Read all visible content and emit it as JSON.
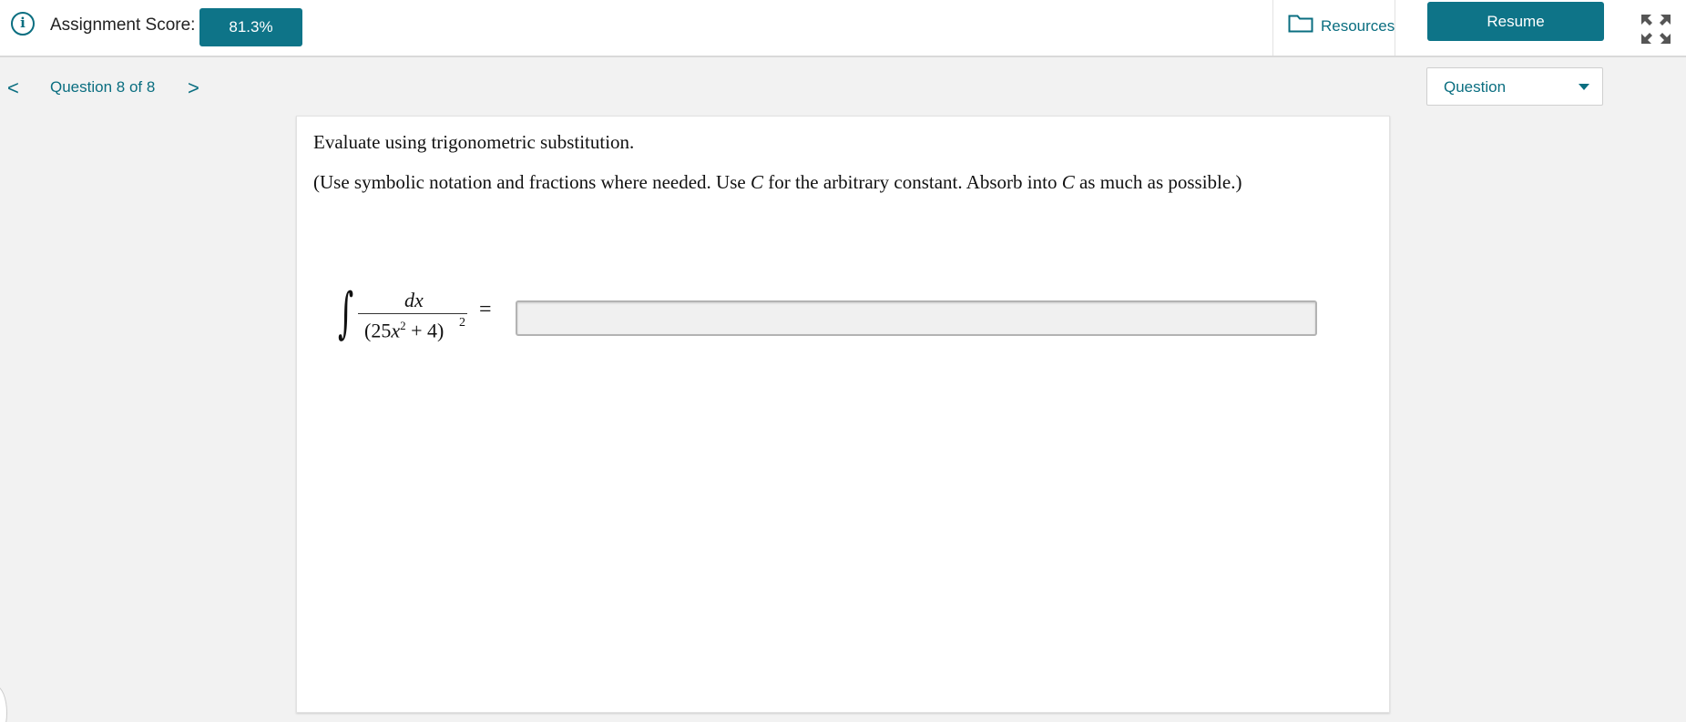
{
  "header": {
    "info_icon": "info-icon",
    "score_label": "Assignment Score:",
    "score_value": "81.3%",
    "resources_label": "Resources",
    "resume_label": "Resume",
    "fullscreen_icon": "fullscreen-icon"
  },
  "nav": {
    "prev_glyph": "<",
    "question_label": "Question 8 of 8",
    "next_glyph": ">"
  },
  "view_select": {
    "selected": "Question"
  },
  "question": {
    "prompt": "Evaluate using trigonometric substitution.",
    "instructions_pre": "(Use symbolic notation and fractions where needed. Use ",
    "constant": "C",
    "instructions_mid": " for the arbitrary constant. Absorb into ",
    "instructions_post": " as much as possible.)",
    "integral": {
      "sign": "∫",
      "numerator": "dx",
      "denominator_open": "(25",
      "denominator_var": "x",
      "denominator_sq": "2",
      "denominator_close": " + 4)",
      "outer_exponent": "2",
      "equals": "="
    },
    "answer_value": ""
  },
  "colors": {
    "accent": "#0e7488",
    "link": "#0a6e80",
    "background": "#f2f2f2"
  }
}
